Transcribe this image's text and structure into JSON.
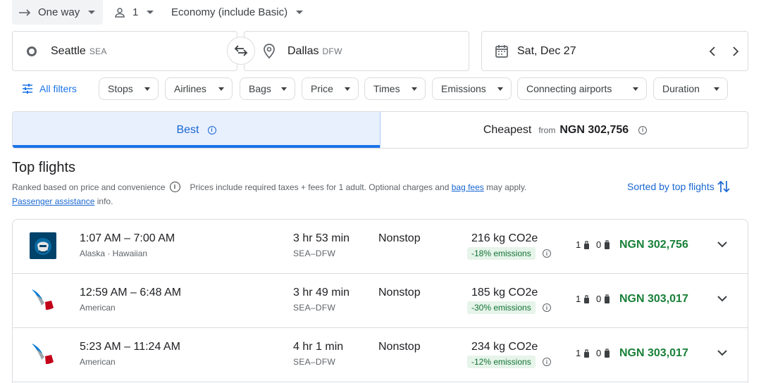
{
  "search": {
    "trip_type": "One way",
    "passengers": "1",
    "cabin": "Economy (include Basic)",
    "origin_city": "Seattle",
    "origin_code": "SEA",
    "dest_city": "Dallas",
    "dest_code": "DFW",
    "date": "Sat, Dec 27"
  },
  "filters": {
    "all_filters": "All filters",
    "chips": [
      "Stops",
      "Airlines",
      "Bags",
      "Price",
      "Times",
      "Emissions",
      "Connecting airports",
      "Duration"
    ]
  },
  "sort_tabs": {
    "best": "Best",
    "cheapest": "Cheapest",
    "cheapest_from": "from",
    "cheapest_price": "NGN 302,756"
  },
  "section": {
    "title": "Top flights",
    "ranked": "Ranked based on price and convenience",
    "prices_note": "Prices include required taxes + fees for 1 adult. Optional charges and",
    "bag_fees": "bag fees",
    "may_apply": "may apply.",
    "passenger_assistance": "Passenger assistance",
    "info": "info.",
    "sorted_by": "Sorted by top flights"
  },
  "flights": [
    {
      "times": "1:07 AM – 7:00 AM",
      "carrier": "Alaska · Hawaiian",
      "duration": "3 hr 53 min",
      "route": "SEA–DFW",
      "stops": "Nonstop",
      "co2": "216 kg CO2e",
      "emissions": "-18% emissions",
      "carry_on": "1",
      "checked": "0",
      "price": "NGN 302,756",
      "logo": "alaska-logo"
    },
    {
      "times": "12:59 AM – 6:48 AM",
      "carrier": "American",
      "duration": "3 hr 49 min",
      "route": "SEA–DFW",
      "stops": "Nonstop",
      "co2": "185 kg CO2e",
      "emissions": "-30% emissions",
      "carry_on": "1",
      "checked": "0",
      "price": "NGN 303,017",
      "logo": "american-logo"
    },
    {
      "times": "5:23 AM – 11:24 AM",
      "carrier": "American",
      "duration": "4 hr 1 min",
      "route": "SEA–DFW",
      "stops": "Nonstop",
      "co2": "234 kg CO2e",
      "emissions": "-12% emissions",
      "carry_on": "1",
      "checked": "0",
      "price": "NGN 303,017",
      "logo": "american-logo"
    }
  ],
  "colors": {
    "accent": "#1a73e8",
    "price_green": "#188038",
    "emission_bg": "#e6f4ea"
  }
}
